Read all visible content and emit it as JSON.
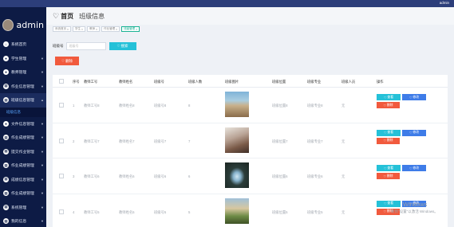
{
  "topbar": {
    "user": "admin"
  },
  "sidebar": {
    "username": "admin",
    "items": [
      {
        "label": "系統首页",
        "icon": "home-icon",
        "has_children": false
      },
      {
        "label": "学生管理",
        "icon": "user-icon",
        "has_children": true
      },
      {
        "label": "教师管理",
        "icon": "user-icon",
        "has_children": true
      },
      {
        "label": "作业信息管理",
        "icon": "grid-icon",
        "has_children": true
      },
      {
        "label": "班级信息管理",
        "icon": "grid-icon",
        "has_children": true,
        "active": true,
        "children": [
          "班级信息"
        ]
      },
      {
        "label": "文件信息管理",
        "icon": "person-icon",
        "has_children": true
      },
      {
        "label": "作业成绩管理",
        "icon": "grid-icon",
        "has_children": true
      },
      {
        "label": "提交作业管理",
        "icon": "grid-icon",
        "has_children": true
      },
      {
        "label": "作业成绩管理",
        "icon": "grid-icon",
        "has_children": true
      },
      {
        "label": "成绩信息管理",
        "icon": "grid-icon",
        "has_children": true
      },
      {
        "label": "作业成绩管理",
        "icon": "grid-icon",
        "has_children": true
      },
      {
        "label": "系统管理",
        "icon": "grid-icon",
        "has_children": true
      },
      {
        "label": "我的信息",
        "icon": "grid-icon",
        "has_children": true
      }
    ]
  },
  "header": {
    "home": "首页",
    "title": "班级信息"
  },
  "tags": [
    "系统首页",
    "学生",
    "教师",
    "作业管理",
    "班级管理"
  ],
  "search": {
    "label": "班级号",
    "placeholder": "班级号",
    "button": "搜索"
  },
  "delete_all": "删除",
  "table": {
    "columns": [
      "",
      "序号",
      "教师工号",
      "教师姓名",
      "班级号",
      "班级人数",
      "班级图片",
      "班级位置",
      "班级专业",
      "班级人员",
      "操作"
    ],
    "rows": [
      {
        "index": "1",
        "teacher_id": "教师工号8",
        "teacher_name": "教师姓名8",
        "class_no": "班级号8",
        "count": "8",
        "location": "班级位置8",
        "major": "班级专业8",
        "members": "无",
        "photo": "beach"
      },
      {
        "index": "2",
        "teacher_id": "教师工号7",
        "teacher_name": "教师姓名7",
        "class_no": "班级号7",
        "count": "7",
        "location": "班级位置7",
        "major": "班级专业7",
        "members": "无",
        "photo": "mountain"
      },
      {
        "index": "3",
        "teacher_id": "教师工号6",
        "teacher_name": "教师姓名6",
        "class_no": "班级号6",
        "count": "6",
        "location": "班级位置6",
        "major": "班级专业6",
        "members": "无",
        "photo": "cave"
      },
      {
        "index": "4",
        "teacher_id": "教师工号5",
        "teacher_name": "教师姓名5",
        "class_no": "班级号5",
        "count": "5",
        "location": "班级位置5",
        "major": "班级专业5",
        "members": "无",
        "photo": "field"
      }
    ],
    "actions": {
      "view": "查看",
      "edit": "修改",
      "delete": "删除"
    }
  },
  "watermark": {
    "title": "Windows",
    "subtitle": "转到\"设置\"以激活 Windows。"
  },
  "colors": {
    "sidebar": "#0d1b45",
    "view": "#25c1d8",
    "edit": "#3e7ce8",
    "delete": "#f15a3d",
    "active_sub": "#59a6ff"
  }
}
